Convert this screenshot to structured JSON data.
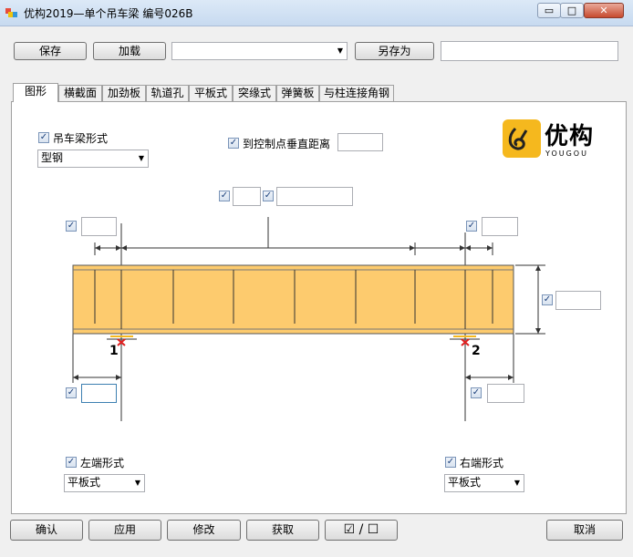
{
  "window": {
    "title": "优构2019—单个吊车梁    编号026B",
    "minimize_glyph": "▭",
    "maximize_glyph": "□",
    "close_glyph": "✕"
  },
  "toolbar": {
    "save_label": "保存",
    "load_label": "加载",
    "template_combo_value": "",
    "save_as_label": "另存为",
    "save_as_name_value": ""
  },
  "tabs": [
    {
      "label": "图形"
    },
    {
      "label": "横截面"
    },
    {
      "label": "加劲板"
    },
    {
      "label": "轨道孔"
    },
    {
      "label": "平板式"
    },
    {
      "label": "突缘式"
    },
    {
      "label": "弹簧板"
    },
    {
      "label": "与柱连接角钢"
    }
  ],
  "graphics": {
    "beam_form": {
      "label": "吊车梁形式",
      "checked": true,
      "value": "型钢"
    },
    "vertical_distance": {
      "label": "到控制点垂直距离",
      "checked": true,
      "value": ""
    },
    "top_center_1": {
      "checked": true,
      "value": ""
    },
    "top_center_2": {
      "checked": true,
      "value": ""
    },
    "left_top": {
      "checked": true,
      "value": ""
    },
    "right_top": {
      "checked": true,
      "value": ""
    },
    "height": {
      "checked": true,
      "value": ""
    },
    "left_bottom": {
      "checked": true,
      "value": ""
    },
    "right_bottom": {
      "checked": true,
      "value": ""
    },
    "left_end": {
      "label": "左端形式",
      "checked": true,
      "value": "平板式"
    },
    "right_end": {
      "label": "右端形式",
      "checked": true,
      "value": "平板式"
    },
    "support_1": "1",
    "support_2": "2",
    "check_glyph": "✓"
  },
  "logo": {
    "brand": "优构",
    "sub": "YOUGOU",
    "color": "#f5b81e"
  },
  "colors": {
    "beam_fill": "#fdcb6e",
    "beam_line": "#555555",
    "support_mark": "#e02020"
  },
  "footer": {
    "confirm_label": "确认",
    "apply_label": "应用",
    "modify_label": "修改",
    "fetch_label": "获取",
    "toggle_label": "☑ / ☐",
    "cancel_label": "取消"
  }
}
